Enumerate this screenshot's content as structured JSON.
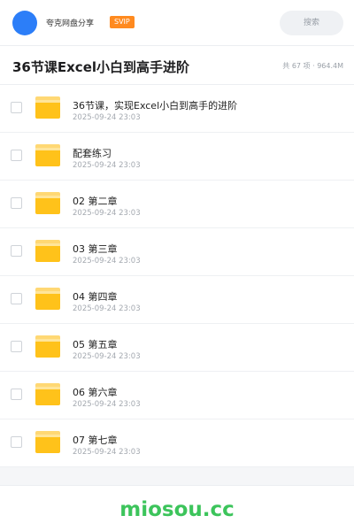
{
  "header": {
    "username": "夸克网盘分享",
    "badge": "SVIP",
    "search_label": "搜索"
  },
  "title_bar": {
    "title": "36节课Excel小白到高手进阶",
    "stats": "共 67 项 · 964.4M"
  },
  "files": [
    {
      "name": "36节课，实现Excel小白到高手的进阶",
      "date": "2025-09-24 23:03"
    },
    {
      "name": "配套练习",
      "date": "2025-09-24 23:03"
    },
    {
      "name": "02 第二章",
      "date": "2025-09-24 23:03"
    },
    {
      "name": "03 第三章",
      "date": "2025-09-24 23:03"
    },
    {
      "name": "04 第四章",
      "date": "2025-09-24 23:03"
    },
    {
      "name": "05 第五章",
      "date": "2025-09-24 23:03"
    },
    {
      "name": "06 第六章",
      "date": "2025-09-24 23:03"
    },
    {
      "name": "07 第七章",
      "date": "2025-09-24 23:03"
    }
  ],
  "footer": {
    "watermark": "miosou.cc"
  },
  "colors": {
    "avatar": "#2c7ef8",
    "badge": "#ff8a1f",
    "folder": "#ffc21a",
    "watermark": "#3cc45b"
  }
}
